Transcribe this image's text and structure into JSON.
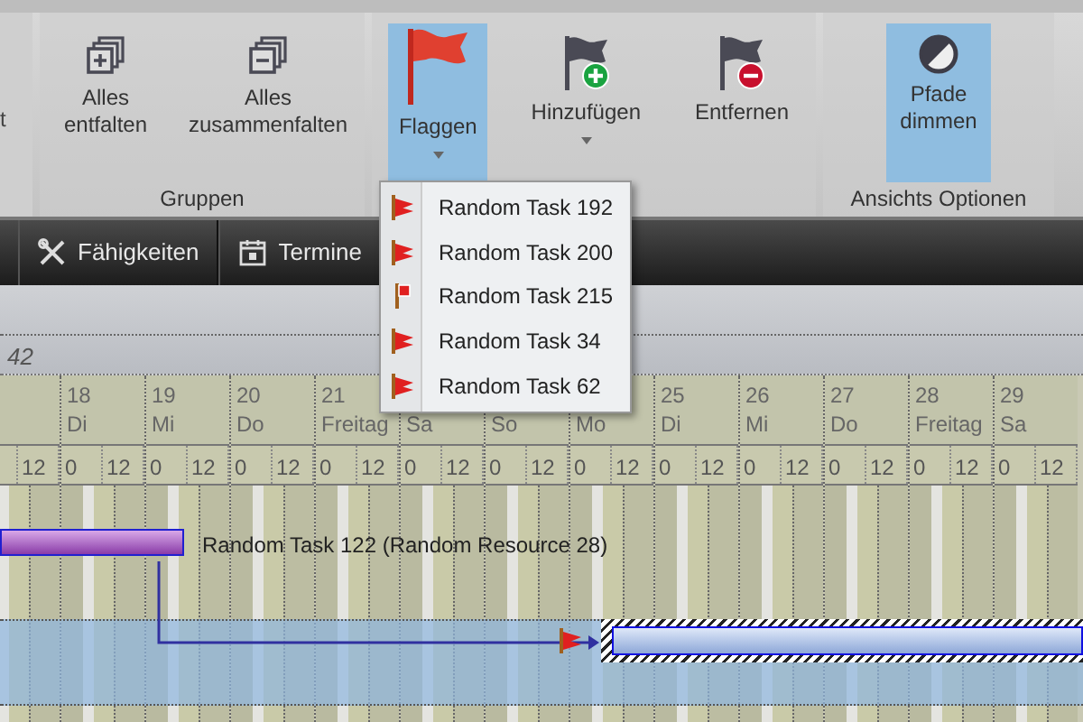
{
  "ribbon": {
    "cut_label": "t",
    "groups": [
      {
        "label": "Gruppen",
        "buttons": [
          {
            "kind": "expand",
            "label": "Alles entfalten",
            "selected": false,
            "dropdown": false
          },
          {
            "kind": "collapse",
            "label": "Alles zusammenfalten",
            "selected": false,
            "dropdown": false
          }
        ]
      },
      {
        "buttons": [
          {
            "kind": "flag",
            "label": "Flaggen",
            "selected": true,
            "dropdown": true
          },
          {
            "kind": "flag-add",
            "label": "Hinzufügen",
            "selected": false,
            "dropdown": true
          },
          {
            "kind": "flag-remove",
            "label": "Entfernen",
            "selected": false,
            "dropdown": false
          }
        ]
      },
      {
        "label": "Ansichts Optionen",
        "buttons": [
          {
            "kind": "dim",
            "label": "Pfade dimmen",
            "selected": true,
            "dropdown": false
          }
        ]
      }
    ]
  },
  "tabs": [
    {
      "kind": "tools",
      "label": "Fähigkeiten"
    },
    {
      "kind": "calendar",
      "label": "Termine"
    }
  ],
  "flag_menu": [
    {
      "kind": "flag",
      "label": "Random Task 192"
    },
    {
      "kind": "flag",
      "label": "Random Task 200"
    },
    {
      "kind": "marker",
      "label": "Random Task 215"
    },
    {
      "kind": "flag",
      "label": "Random Task 34"
    },
    {
      "kind": "flag",
      "label": "Random Task 62"
    }
  ],
  "project_row": {
    "text": "42"
  },
  "timeline": {
    "days": [
      {
        "hours": [
          "12"
        ]
      },
      {
        "number": "18",
        "name": "Di",
        "hours": [
          "0",
          "12"
        ]
      },
      {
        "number": "19",
        "name": "Mi",
        "hours": [
          "0",
          "12"
        ]
      },
      {
        "number": "20",
        "name": "Do",
        "hours": [
          "0",
          "12"
        ]
      },
      {
        "number": "21",
        "name": "Freitag",
        "hours": [
          "0",
          "12"
        ]
      },
      {
        "name": "Sa",
        "hours": [
          "0",
          "12"
        ]
      },
      {
        "name": "So",
        "hours": [
          "0",
          "12"
        ]
      },
      {
        "name": "Mo",
        "hours": [
          "0",
          "12"
        ]
      },
      {
        "number": "25",
        "name": "Di",
        "hours": [
          "0",
          "12"
        ]
      },
      {
        "number": "26",
        "name": "Mi",
        "hours": [
          "0",
          "12"
        ]
      },
      {
        "number": "27",
        "name": "Do",
        "hours": [
          "0",
          "12"
        ]
      },
      {
        "number": "28",
        "name": "Freitag",
        "hours": [
          "0",
          "12"
        ]
      },
      {
        "number": "29",
        "name": "Sa",
        "hours": [
          "0",
          "12"
        ]
      }
    ]
  },
  "gantt_rows": [
    {
      "kind": "summary",
      "label": "Random Task 122 (Random Resource 28)",
      "selected": false
    },
    {
      "kind": "flagged",
      "selected": true
    }
  ]
}
